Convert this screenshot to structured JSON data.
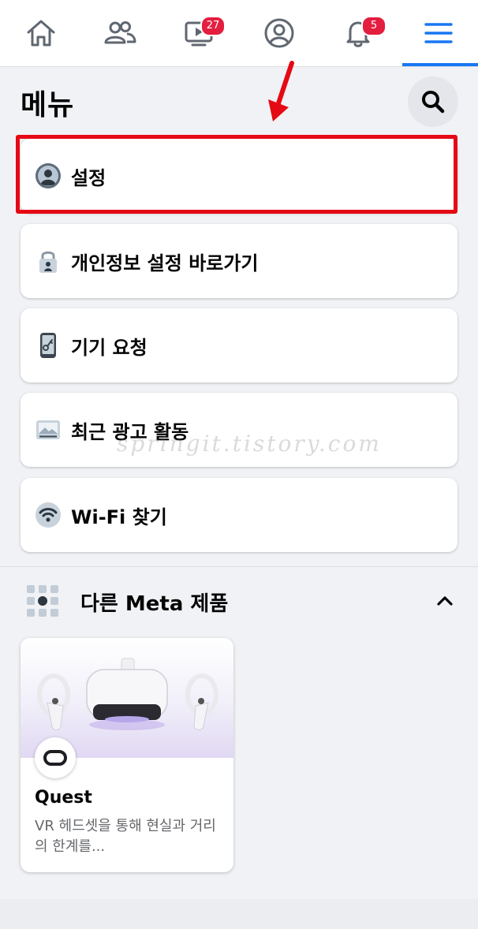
{
  "nav": {
    "items": [
      {
        "name": "home",
        "icon": "home-icon"
      },
      {
        "name": "friends",
        "icon": "friends-icon"
      },
      {
        "name": "watch",
        "icon": "video-icon",
        "badge": "27"
      },
      {
        "name": "profile",
        "icon": "profile-icon"
      },
      {
        "name": "notifications",
        "icon": "bell-icon",
        "badge": "5"
      },
      {
        "name": "menu",
        "icon": "hamburger-icon",
        "active": true
      }
    ],
    "accent": "#1877f2",
    "badge_color": "#e41e3f"
  },
  "header": {
    "title": "메뉴",
    "search_icon": "search-icon"
  },
  "menu_items": [
    {
      "label": "설정",
      "icon": "person-circle-icon",
      "highlighted": true
    },
    {
      "label": "개인정보 설정 바로가기",
      "icon": "lock-icon"
    },
    {
      "label": "기기 요청",
      "icon": "phone-key-icon"
    },
    {
      "label": "최근 광고 활동",
      "icon": "ad-image-icon"
    },
    {
      "label": "Wi-Fi 찾기",
      "icon": "wifi-icon"
    }
  ],
  "annotation": {
    "highlight_color": "#e50914",
    "arrow_icon": "red-arrow-icon"
  },
  "section": {
    "title": "다른 Meta 제품",
    "icon": "grid-dots-icon",
    "toggle_icon": "chevron-up-icon"
  },
  "products": [
    {
      "name": "Quest",
      "description": "VR 헤드셋을 통해 현실과 거리의 한계를...",
      "icon": "quest-logo-icon",
      "image": "vr-headset-image"
    }
  ],
  "watermark": "springit.tistory.com"
}
